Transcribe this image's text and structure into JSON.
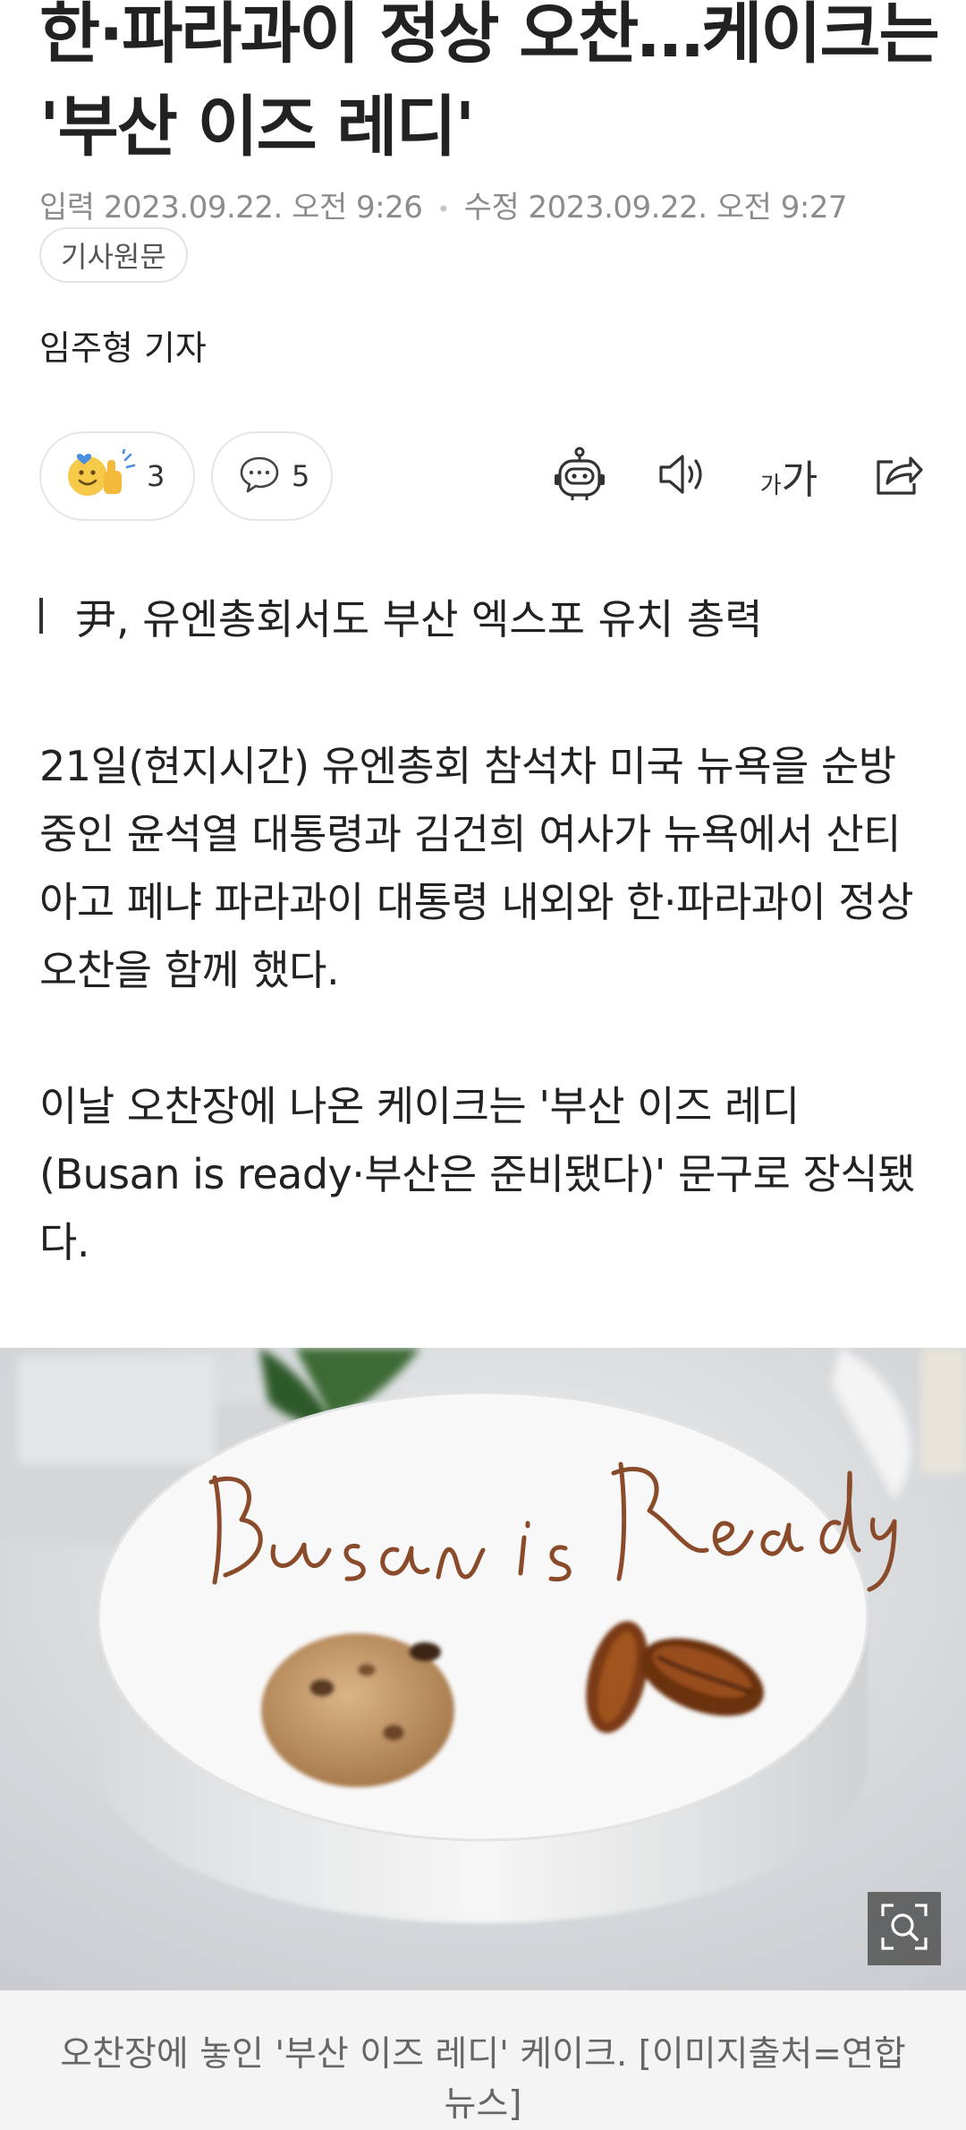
{
  "article": {
    "title": "한·파라과이 정상 오찬…케이크는 '부산 이즈 레디'",
    "input_label": "입력",
    "input_time": "2023.09.22. 오전 9:26",
    "edit_label": "수정",
    "edit_time": "2023.09.22. 오전 9:27",
    "original_button": "기사원문",
    "reporter": "임주형 기자",
    "subheading": "尹, 유엔총회서도 부산 엑스포 유치 총력",
    "paragraphs": [
      "21일(현지시간) 유엔총회 참석차 미국 뉴욕을 순방 중인 윤석열 대통령과 김건희 여사가 뉴욕에서 산티아고 페냐 파라과이 대통령 내외와 한·파라과이 정상 오찬을 함께 했다.",
      "이날 오찬장에 나온 케이크는 '부산 이즈 레디(Busan is ready·부산은 준비됐다)' 문구로 장식됐다."
    ],
    "image_inscription": "Busan is Ready",
    "image_caption": "오찬장에 놓인 '부산 이즈 레디' 케이크. [이미지출처=연합뉴스]"
  },
  "actions": {
    "reaction_count": "3",
    "comment_count": "5",
    "font_small": "가",
    "font_large": "가"
  },
  "icons": [
    "reaction-emoji-icon",
    "comment-icon",
    "robot-summary-icon",
    "speaker-icon",
    "font-size-icon",
    "share-icon",
    "zoom-icon"
  ],
  "colors": {
    "text": "#222222",
    "meta": "#8c8c8c",
    "caption_bg": "#f4f4f4",
    "border": "#e5e5e5"
  }
}
